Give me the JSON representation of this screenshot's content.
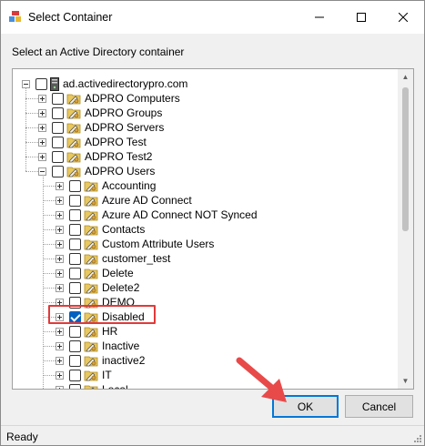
{
  "window": {
    "title": "Select Container",
    "prompt": "Select an Active Directory container"
  },
  "tree": {
    "root": {
      "label": "ad.activedirectorypro.com",
      "expanded": true
    },
    "level1": [
      {
        "label": "ADPRO Computers",
        "expanded": false
      },
      {
        "label": "ADPRO Groups",
        "expanded": false
      },
      {
        "label": "ADPRO Servers",
        "expanded": false
      },
      {
        "label": "ADPRO Test",
        "expanded": false
      },
      {
        "label": "ADPRO Test2",
        "expanded": false
      },
      {
        "label": "ADPRO Users",
        "expanded": true
      }
    ],
    "level2": [
      {
        "label": "Accounting",
        "checked": false
      },
      {
        "label": "Azure AD Connect",
        "checked": false
      },
      {
        "label": "Azure AD Connect NOT Synced",
        "checked": false
      },
      {
        "label": "Contacts",
        "checked": false
      },
      {
        "label": "Custom Attribute Users",
        "checked": false
      },
      {
        "label": "customer_test",
        "checked": false
      },
      {
        "label": "Delete",
        "checked": false
      },
      {
        "label": "Delete2",
        "checked": false
      },
      {
        "label": "DEMO",
        "checked": false
      },
      {
        "label": "Disabled",
        "checked": true
      },
      {
        "label": "HR",
        "checked": false
      },
      {
        "label": "Inactive",
        "checked": false
      },
      {
        "label": "inactive2",
        "checked": false
      },
      {
        "label": "IT",
        "checked": false
      },
      {
        "label": "Local",
        "checked": false
      }
    ]
  },
  "buttons": {
    "ok": "OK",
    "cancel": "Cancel"
  },
  "status": "Ready",
  "colors": {
    "highlight": "#e03a3a",
    "check": "#0060c0",
    "default_button_border": "#0078d7",
    "pointer_arrow": "#e84a4a"
  }
}
